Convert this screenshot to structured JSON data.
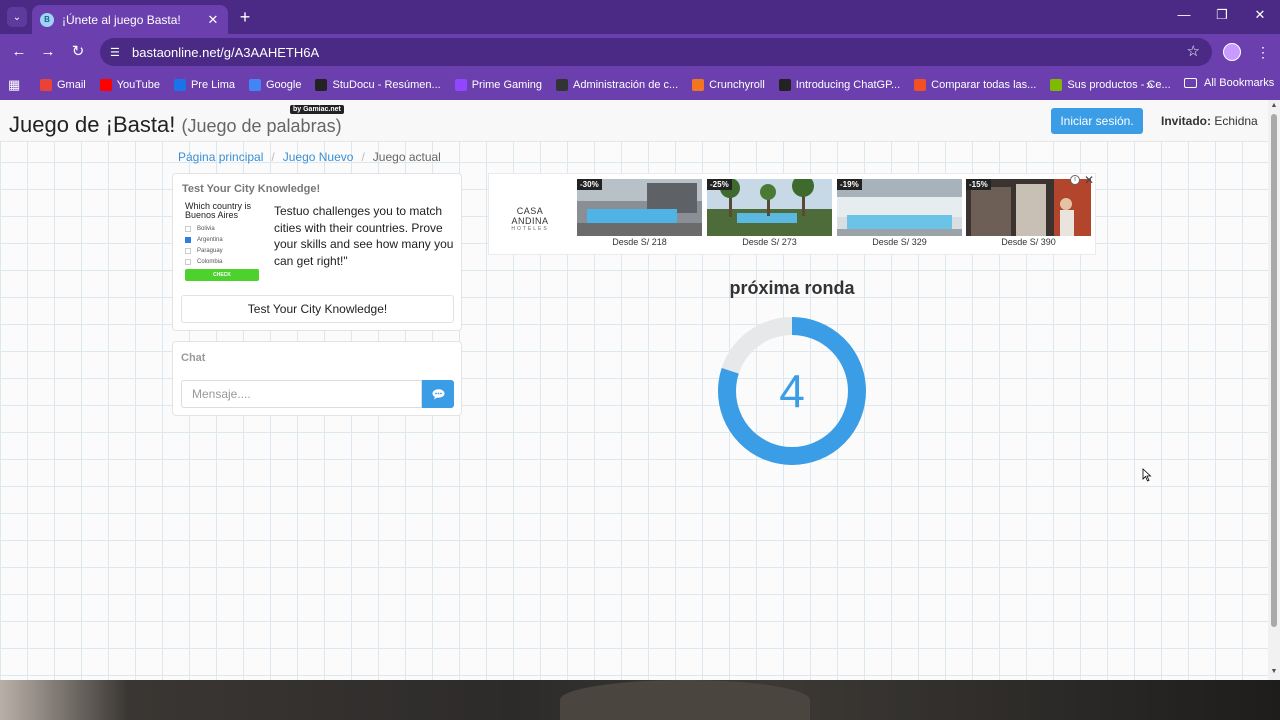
{
  "browser": {
    "tab_title": "¡Únete al juego Basta!",
    "url": "bastaonline.net/g/A3AAHETH6A",
    "bookmarks": [
      {
        "label": "Gmail",
        "icon": "gmail-icon",
        "color": "#ea4335"
      },
      {
        "label": "YouTube",
        "icon": "youtube-icon",
        "color": "#ff0000"
      },
      {
        "label": "Pre Lima",
        "icon": "prelima-icon",
        "color": "#1a73e8"
      },
      {
        "label": "Google",
        "icon": "google-icon",
        "color": "#4285f4"
      },
      {
        "label": "StuDocu - Resúmen...",
        "icon": "studocu-icon",
        "color": "#222222"
      },
      {
        "label": "Prime Gaming",
        "icon": "prime-gaming-icon",
        "color": "#9146ff"
      },
      {
        "label": "Administración de c...",
        "icon": "admin-icon",
        "color": "#333333"
      },
      {
        "label": "Crunchyroll",
        "icon": "crunchyroll-icon",
        "color": "#f47521"
      },
      {
        "label": "Introducing ChatGP...",
        "icon": "openai-icon",
        "color": "#222222"
      },
      {
        "label": "Comparar todas las...",
        "icon": "microsoft-icon",
        "color": "#f25022"
      },
      {
        "label": "Sus productos - Ce...",
        "icon": "microsoft-icon",
        "color": "#7fba00"
      }
    ],
    "all_bookmarks": "All Bookmarks"
  },
  "header": {
    "title": "Juego de ¡Basta!",
    "subtitle": "(Juego de palabras)",
    "badge": "by Gamiac.net",
    "login_label": "Iniciar sesión.",
    "guest_label": "Invitado:",
    "guest_name": "Echidna"
  },
  "breadcrumb": {
    "home": "Página principal",
    "new_game": "Juego Nuevo",
    "current": "Juego actual",
    "separator": "/"
  },
  "ad": {
    "heading": "Test Your City Knowledge!",
    "question": "Which country is Buenos Aires",
    "options": [
      "Bolivia",
      "Argentina",
      "Paraguay",
      "Colombia"
    ],
    "check_label": "CHECK",
    "text": "Testuo challenges you to match cities with their countries. Prove your skills and see how many you can get right!\"",
    "cta": "Test Your City Knowledge!"
  },
  "chat": {
    "title": "Chat",
    "placeholder": "Mensaje...."
  },
  "banner": {
    "brand": "CASA ANDINA",
    "brand_sub": "HOTELES",
    "offers": [
      {
        "discount": "-30%",
        "price": "Desde S/ 218"
      },
      {
        "discount": "-25%",
        "price": "Desde S/ 273"
      },
      {
        "discount": "-19%",
        "price": "Desde S/ 329"
      },
      {
        "discount": "-15%",
        "price": "Desde S/ 390"
      }
    ]
  },
  "round": {
    "title": "próxima ronda",
    "countdown": "4",
    "progress_fraction": 0.8,
    "accent_color": "#3a9de6"
  }
}
